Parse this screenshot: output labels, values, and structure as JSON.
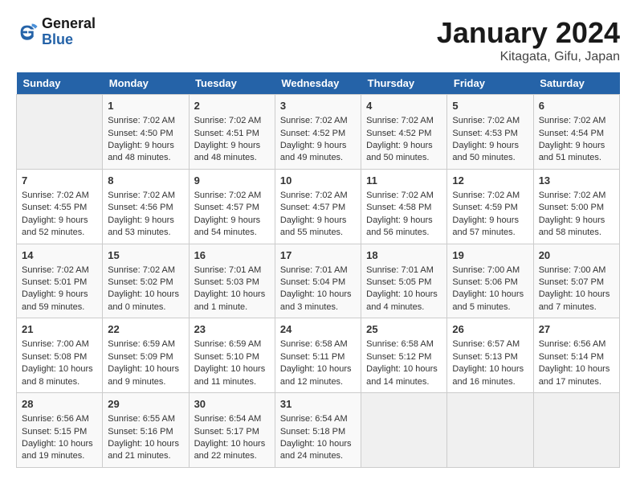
{
  "header": {
    "logo_line1": "General",
    "logo_line2": "Blue",
    "month": "January 2024",
    "location": "Kitagata, Gifu, Japan"
  },
  "weekdays": [
    "Sunday",
    "Monday",
    "Tuesday",
    "Wednesday",
    "Thursday",
    "Friday",
    "Saturday"
  ],
  "weeks": [
    [
      {
        "day": "",
        "empty": true
      },
      {
        "day": "1",
        "sunrise": "7:02 AM",
        "sunset": "4:50 PM",
        "daylight": "9 hours and 48 minutes."
      },
      {
        "day": "2",
        "sunrise": "7:02 AM",
        "sunset": "4:51 PM",
        "daylight": "9 hours and 48 minutes."
      },
      {
        "day": "3",
        "sunrise": "7:02 AM",
        "sunset": "4:52 PM",
        "daylight": "9 hours and 49 minutes."
      },
      {
        "day": "4",
        "sunrise": "7:02 AM",
        "sunset": "4:52 PM",
        "daylight": "9 hours and 50 minutes."
      },
      {
        "day": "5",
        "sunrise": "7:02 AM",
        "sunset": "4:53 PM",
        "daylight": "9 hours and 50 minutes."
      },
      {
        "day": "6",
        "sunrise": "7:02 AM",
        "sunset": "4:54 PM",
        "daylight": "9 hours and 51 minutes."
      }
    ],
    [
      {
        "day": "7",
        "sunrise": "7:02 AM",
        "sunset": "4:55 PM",
        "daylight": "9 hours and 52 minutes."
      },
      {
        "day": "8",
        "sunrise": "7:02 AM",
        "sunset": "4:56 PM",
        "daylight": "9 hours and 53 minutes."
      },
      {
        "day": "9",
        "sunrise": "7:02 AM",
        "sunset": "4:57 PM",
        "daylight": "9 hours and 54 minutes."
      },
      {
        "day": "10",
        "sunrise": "7:02 AM",
        "sunset": "4:57 PM",
        "daylight": "9 hours and 55 minutes."
      },
      {
        "day": "11",
        "sunrise": "7:02 AM",
        "sunset": "4:58 PM",
        "daylight": "9 hours and 56 minutes."
      },
      {
        "day": "12",
        "sunrise": "7:02 AM",
        "sunset": "4:59 PM",
        "daylight": "9 hours and 57 minutes."
      },
      {
        "day": "13",
        "sunrise": "7:02 AM",
        "sunset": "5:00 PM",
        "daylight": "9 hours and 58 minutes."
      }
    ],
    [
      {
        "day": "14",
        "sunrise": "7:02 AM",
        "sunset": "5:01 PM",
        "daylight": "9 hours and 59 minutes."
      },
      {
        "day": "15",
        "sunrise": "7:02 AM",
        "sunset": "5:02 PM",
        "daylight": "10 hours and 0 minutes."
      },
      {
        "day": "16",
        "sunrise": "7:01 AM",
        "sunset": "5:03 PM",
        "daylight": "10 hours and 1 minute."
      },
      {
        "day": "17",
        "sunrise": "7:01 AM",
        "sunset": "5:04 PM",
        "daylight": "10 hours and 3 minutes."
      },
      {
        "day": "18",
        "sunrise": "7:01 AM",
        "sunset": "5:05 PM",
        "daylight": "10 hours and 4 minutes."
      },
      {
        "day": "19",
        "sunrise": "7:00 AM",
        "sunset": "5:06 PM",
        "daylight": "10 hours and 5 minutes."
      },
      {
        "day": "20",
        "sunrise": "7:00 AM",
        "sunset": "5:07 PM",
        "daylight": "10 hours and 7 minutes."
      }
    ],
    [
      {
        "day": "21",
        "sunrise": "7:00 AM",
        "sunset": "5:08 PM",
        "daylight": "10 hours and 8 minutes."
      },
      {
        "day": "22",
        "sunrise": "6:59 AM",
        "sunset": "5:09 PM",
        "daylight": "10 hours and 9 minutes."
      },
      {
        "day": "23",
        "sunrise": "6:59 AM",
        "sunset": "5:10 PM",
        "daylight": "10 hours and 11 minutes."
      },
      {
        "day": "24",
        "sunrise": "6:58 AM",
        "sunset": "5:11 PM",
        "daylight": "10 hours and 12 minutes."
      },
      {
        "day": "25",
        "sunrise": "6:58 AM",
        "sunset": "5:12 PM",
        "daylight": "10 hours and 14 minutes."
      },
      {
        "day": "26",
        "sunrise": "6:57 AM",
        "sunset": "5:13 PM",
        "daylight": "10 hours and 16 minutes."
      },
      {
        "day": "27",
        "sunrise": "6:56 AM",
        "sunset": "5:14 PM",
        "daylight": "10 hours and 17 minutes."
      }
    ],
    [
      {
        "day": "28",
        "sunrise": "6:56 AM",
        "sunset": "5:15 PM",
        "daylight": "10 hours and 19 minutes."
      },
      {
        "day": "29",
        "sunrise": "6:55 AM",
        "sunset": "5:16 PM",
        "daylight": "10 hours and 21 minutes."
      },
      {
        "day": "30",
        "sunrise": "6:54 AM",
        "sunset": "5:17 PM",
        "daylight": "10 hours and 22 minutes."
      },
      {
        "day": "31",
        "sunrise": "6:54 AM",
        "sunset": "5:18 PM",
        "daylight": "10 hours and 24 minutes."
      },
      {
        "day": "",
        "empty": true
      },
      {
        "day": "",
        "empty": true
      },
      {
        "day": "",
        "empty": true
      }
    ]
  ]
}
